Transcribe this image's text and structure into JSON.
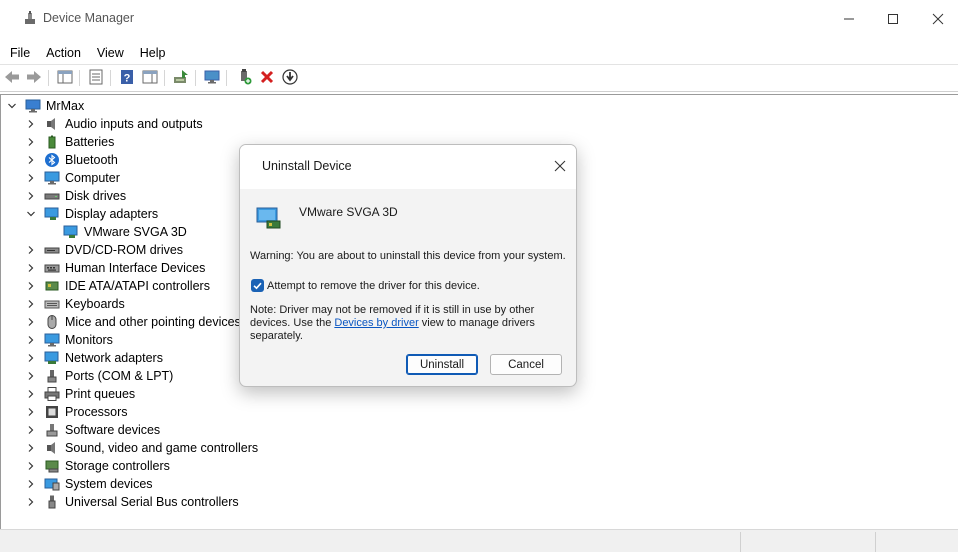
{
  "window": {
    "title": "Device Manager"
  },
  "menu": [
    "File",
    "Action",
    "View",
    "Help"
  ],
  "tree": {
    "root": "MrMax",
    "items": [
      {
        "label": "Audio inputs and outputs",
        "icon": "speaker-icon",
        "expanded": false
      },
      {
        "label": "Batteries",
        "icon": "battery-icon",
        "expanded": false
      },
      {
        "label": "Bluetooth",
        "icon": "bluetooth-icon",
        "expanded": false
      },
      {
        "label": "Computer",
        "icon": "computer-icon",
        "expanded": false
      },
      {
        "label": "Disk drives",
        "icon": "disk-drive-icon",
        "expanded": false
      },
      {
        "label": "Display adapters",
        "icon": "display-adapter-icon",
        "expanded": true
      },
      {
        "label": "VMware SVGA 3D",
        "icon": "display-adapter-icon",
        "child": true
      },
      {
        "label": "DVD/CD-ROM drives",
        "icon": "dvd-drive-icon",
        "expanded": false
      },
      {
        "label": "Human Interface Devices",
        "icon": "hid-icon",
        "expanded": false
      },
      {
        "label": "IDE ATA/ATAPI controllers",
        "icon": "ide-controller-icon",
        "expanded": false
      },
      {
        "label": "Keyboards",
        "icon": "keyboard-icon",
        "expanded": false
      },
      {
        "label": "Mice and other pointing devices",
        "icon": "mouse-icon",
        "expanded": false
      },
      {
        "label": "Monitors",
        "icon": "monitor-icon",
        "expanded": false
      },
      {
        "label": "Network adapters",
        "icon": "network-adapter-icon",
        "expanded": false
      },
      {
        "label": "Ports (COM & LPT)",
        "icon": "port-icon",
        "expanded": false
      },
      {
        "label": "Print queues",
        "icon": "printer-icon",
        "expanded": false
      },
      {
        "label": "Processors",
        "icon": "processor-icon",
        "expanded": false
      },
      {
        "label": "Software devices",
        "icon": "software-device-icon",
        "expanded": false
      },
      {
        "label": "Sound, video and game controllers",
        "icon": "speaker-icon",
        "expanded": false
      },
      {
        "label": "Storage controllers",
        "icon": "storage-controller-icon",
        "expanded": false
      },
      {
        "label": "System devices",
        "icon": "system-device-icon",
        "expanded": false
      },
      {
        "label": "Universal Serial Bus controllers",
        "icon": "usb-icon",
        "expanded": false
      }
    ]
  },
  "dialog": {
    "title": "Uninstall Device",
    "device_name": "VMware SVGA 3D",
    "warning": "Warning: You are about to uninstall this device from your system.",
    "checkbox_label": "Attempt to remove the driver for this device.",
    "checkbox_checked": true,
    "note_before": "Note: Driver may not be removed if it is still in use by other devices. Use the ",
    "note_link": "Devices by driver",
    "note_after": " view to manage drivers separately.",
    "uninstall_label": "Uninstall",
    "cancel_label": "Cancel"
  },
  "colors": {
    "accent": "#0f5ab5",
    "link": "#0a56c2",
    "delete_red": "#d42020"
  }
}
